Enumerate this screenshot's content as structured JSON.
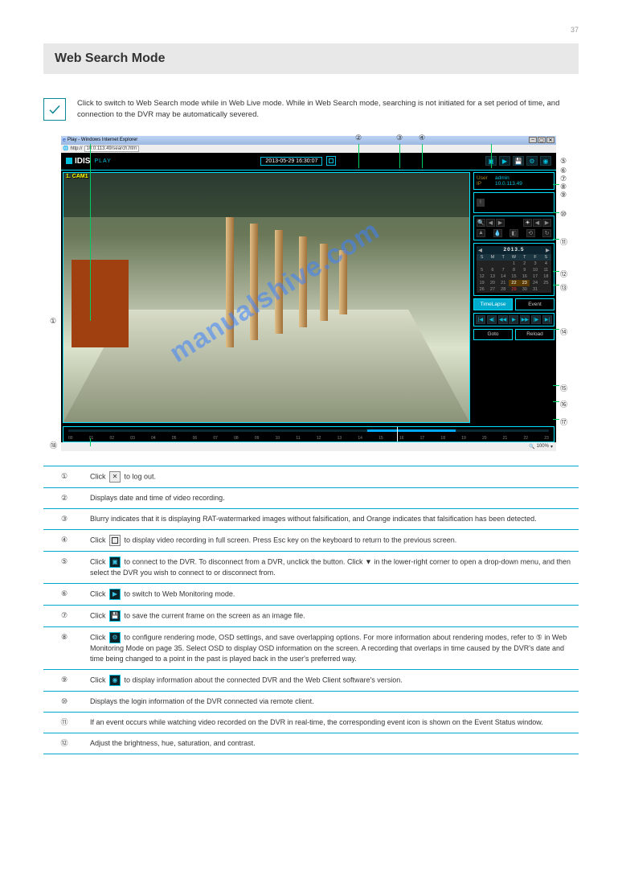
{
  "page_number": "37",
  "section_header": "Web Search Mode",
  "note_text": "Click  to switch to Web Search mode while in Web Live mode. While in Web Search mode, searching is not initiated for a set period of time, and connection to the DVR may be automatically severed.",
  "browser": {
    "title": "Play - Windows Internet Explorer",
    "url_prefix": "http://",
    "url": "10.0.113.49/search.htm",
    "zoom": "100%"
  },
  "app": {
    "brand": "IDIS",
    "mode": "PLAY",
    "datetime": "2013-05-29 16:30:07",
    "camera_label": "1. CAM1",
    "watermark": "manualshive.com",
    "info": {
      "user_label": "User",
      "user_val": "admin",
      "ip_label": "IP",
      "ip_val": "10.0.113.49"
    },
    "calendar": {
      "title": "2013.5",
      "dow": [
        "S",
        "M",
        "T",
        "W",
        "T",
        "F",
        "S"
      ],
      "cells": [
        {
          "t": "",
          "dim": true
        },
        {
          "t": "",
          "dim": true
        },
        {
          "t": "",
          "dim": true
        },
        {
          "t": "1"
        },
        {
          "t": "2"
        },
        {
          "t": "3"
        },
        {
          "t": "4"
        },
        {
          "t": "5"
        },
        {
          "t": "6"
        },
        {
          "t": "7"
        },
        {
          "t": "8"
        },
        {
          "t": "9"
        },
        {
          "t": "10"
        },
        {
          "t": "11"
        },
        {
          "t": "12"
        },
        {
          "t": "13"
        },
        {
          "t": "14"
        },
        {
          "t": "15"
        },
        {
          "t": "16"
        },
        {
          "t": "17"
        },
        {
          "t": "18"
        },
        {
          "t": "19"
        },
        {
          "t": "20"
        },
        {
          "t": "21"
        },
        {
          "t": "22",
          "hl": true
        },
        {
          "t": "23",
          "hl": true
        },
        {
          "t": "24"
        },
        {
          "t": "25"
        },
        {
          "t": "26"
        },
        {
          "t": "27"
        },
        {
          "t": "28"
        },
        {
          "t": "29",
          "today": true
        },
        {
          "t": "30"
        },
        {
          "t": "31"
        },
        {
          "t": "",
          "dim": true
        }
      ]
    },
    "mode_tabs": {
      "timelapse": "TimeLapse",
      "event": "Event"
    },
    "goto": "Goto",
    "reload": "Reload",
    "timeline_ticks": [
      "00",
      "01",
      "02",
      "03",
      "04",
      "05",
      "06",
      "07",
      "08",
      "09",
      "10",
      "11",
      "12",
      "13",
      "14",
      "15",
      "16",
      "17",
      "18",
      "19",
      "20",
      "21",
      "22",
      "23"
    ]
  },
  "callouts": {
    "c1": "①",
    "c2": "②",
    "c3": "③",
    "c4": "④",
    "c5": "⑤",
    "c6": "⑥",
    "c7": "⑦",
    "c8": "⑧",
    "c9": "⑨",
    "c10": "⑩",
    "c11": "⑪",
    "c12": "⑫",
    "c13": "⑬",
    "c14": "⑭",
    "c15": "⑮",
    "c16": "⑯",
    "c17": "⑰",
    "c18": "⑱"
  },
  "rows": [
    {
      "n": "①",
      "html": "Click      to log out."
    },
    {
      "n": "②",
      "html": "Displays date and time of video recording."
    },
    {
      "n": "③",
      "html": "Blurry indicates that it is displaying RAT-watermarked images without falsification, and Orange indicates that falsification has been detected."
    },
    {
      "n": "④",
      "html": "Click      to display video recording in full screen. Press Esc key on the keyboard to return to the previous screen."
    },
    {
      "n": "⑤",
      "html": "Click      to connect to the DVR. To disconnect from a DVR, unclick the button. Click ▼ in the lower-right corner to open a drop-down menu, and then select the DVR you wish to connect to or disconnect from."
    },
    {
      "n": "⑥",
      "html": "Click      to switch to Web Monitoring mode."
    },
    {
      "n": "⑦",
      "html": "Click      to save the current frame on the screen as an image file."
    },
    {
      "n": "⑧",
      "html": "Click      to configure rendering mode, OSD settings, and save overlapping options. For more information about rendering modes, refer to ⑤ in Web Monitoring Mode on page 35. Select OSD to display OSD information on the screen. A recording that overlaps in time caused by the DVR's date and time being changed to a point in the past is played back in the user's preferred way."
    },
    {
      "n": "⑨",
      "html": "Click      to display information about the connected DVR and the Web Client software's version."
    },
    {
      "n": "⑩",
      "html": "Displays the login information of the DVR connected via remote client."
    },
    {
      "n": "⑪",
      "html": "If an event occurs while watching video recorded on the DVR in real-time, the corresponding event icon is shown on the Event Status window."
    },
    {
      "n": "⑫",
      "html": "Adjust the brightness, hue, saturation, and contrast."
    }
  ]
}
